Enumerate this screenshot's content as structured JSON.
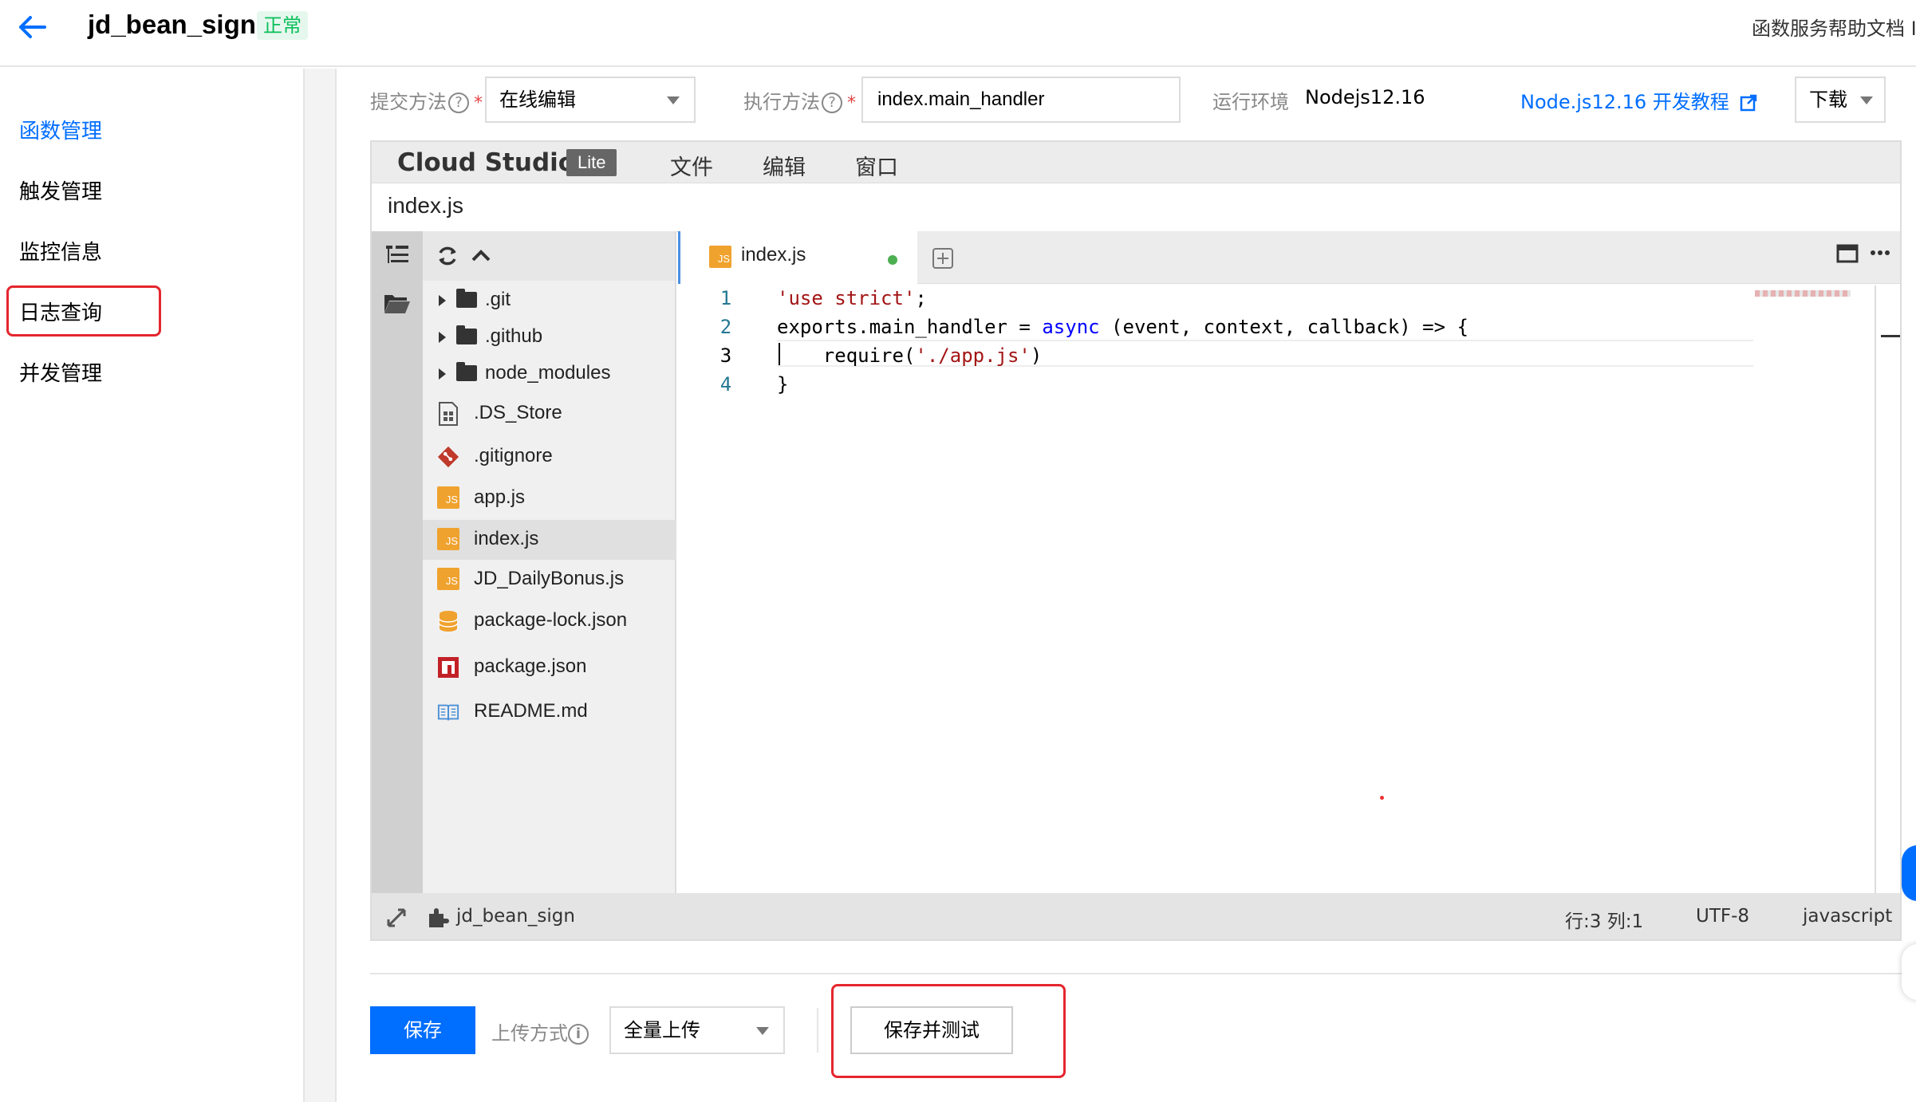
{
  "header": {
    "title": "jd_bean_sign",
    "status": "正常",
    "help_link": "函数服务帮助文档 I"
  },
  "sidebar": {
    "items": [
      {
        "label": "函数管理",
        "active": true
      },
      {
        "label": "触发管理",
        "active": false
      },
      {
        "label": "监控信息",
        "active": false
      },
      {
        "label": "日志查询",
        "active": false
      },
      {
        "label": "并发管理",
        "active": false
      }
    ]
  },
  "form": {
    "submit_method_label": "提交方法",
    "submit_method_value": "在线编辑",
    "exec_method_label": "执行方法",
    "exec_method_value": "index.main_handler",
    "runtime_label": "运行环境",
    "runtime_value": "Nodejs12.16",
    "tutorial_link": "Node.js12.16 开发教程",
    "download_label": "下载"
  },
  "ide": {
    "brand": "Cloud Studio",
    "brand_badge": "Lite",
    "menus": [
      "文件",
      "编辑",
      "窗口"
    ],
    "file_title": "index.js",
    "tab_label": "index.js",
    "tree": [
      {
        "label": ".git",
        "type": "folder"
      },
      {
        "label": ".github",
        "type": "folder"
      },
      {
        "label": "node_modules",
        "type": "folder"
      },
      {
        "label": ".DS_Store",
        "type": "file"
      },
      {
        "label": ".gitignore",
        "type": "git"
      },
      {
        "label": "app.js",
        "type": "js"
      },
      {
        "label": "index.js",
        "type": "js",
        "selected": true
      },
      {
        "label": "JD_DailyBonus.js",
        "type": "js"
      },
      {
        "label": "package-lock.json",
        "type": "db"
      },
      {
        "label": "package.json",
        "type": "npm"
      },
      {
        "label": "README.md",
        "type": "md"
      }
    ],
    "code": {
      "line_numbers": [
        "1",
        "2",
        "3",
        "4"
      ],
      "line1_str": "'use strict'",
      "line1_end": ";",
      "line2_a": "exports.main_handler = ",
      "line2_kw": "async",
      "line2_b": " (event, context, callback) => {",
      "line3_a": "    require(",
      "line3_str": "'./app.js'",
      "line3_b": ")",
      "line4": "}"
    },
    "status": {
      "project": "jd_bean_sign",
      "cursor": "行:3 列:1",
      "encoding": "UTF-8",
      "language": "javascript"
    }
  },
  "bottom": {
    "save_label": "保存",
    "upload_label": "上传方式",
    "upload_value": "全量上传",
    "save_test_label": "保存并测试"
  }
}
